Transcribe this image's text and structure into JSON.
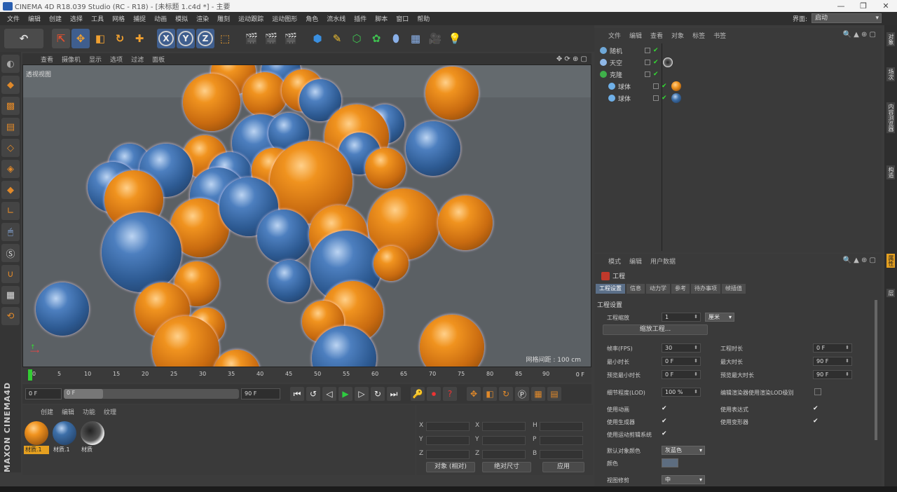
{
  "window": {
    "title": "CINEMA 4D R18.039 Studio (RC - R18) - [未标题 1.c4d *] - 主要"
  },
  "menu": [
    "文件",
    "编辑",
    "创建",
    "选择",
    "工具",
    "网格",
    "捕捉",
    "动画",
    "模拟",
    "渲染",
    "雕刻",
    "运动跟踪",
    "运动图形",
    "角色",
    "流水线",
    "插件",
    "脚本",
    "窗口",
    "帮助"
  ],
  "layout": {
    "label": "界面:",
    "value": "启动"
  },
  "viewport": {
    "menu": [
      "查看",
      "摄像机",
      "显示",
      "选项",
      "过滤",
      "面板"
    ],
    "label": "透视视图",
    "grid_spacing": "网格间距 : 100 cm"
  },
  "timeline": {
    "ticks": [
      "0",
      "5",
      "10",
      "15",
      "20",
      "25",
      "30",
      "35",
      "40",
      "45",
      "50",
      "55",
      "60",
      "65",
      "70",
      "75",
      "80",
      "85",
      "90"
    ],
    "current_frame": "0 F"
  },
  "transport": {
    "start": "0 F",
    "slider": "0 F",
    "end": "90 F"
  },
  "materials": {
    "menu": [
      "创建",
      "编辑",
      "功能",
      "纹理"
    ],
    "items": [
      {
        "name": "材质.1",
        "color": "orange",
        "selected": true
      },
      {
        "name": "材质.1",
        "color": "blue",
        "selected": false
      },
      {
        "name": "材质",
        "color": "glass",
        "selected": false
      }
    ]
  },
  "coords": {
    "labels_col1": [
      "X",
      "Y",
      "Z"
    ],
    "labels_col2": [
      "X",
      "Y",
      "Z"
    ],
    "labels_col3": [
      "H",
      "P",
      "B"
    ],
    "mode1": "对象 (相对)",
    "mode2": "绝对尺寸",
    "apply": "应用"
  },
  "objects": {
    "menu": [
      "文件",
      "编辑",
      "查看",
      "对象",
      "标签",
      "书签"
    ],
    "items": [
      {
        "name": "随机",
        "icon": "gear-icon",
        "color": "#6fa8d8",
        "indent": 0
      },
      {
        "name": "天空",
        "icon": "sphere-icon",
        "color": "#8fb8e8",
        "indent": 0
      },
      {
        "name": "克隆",
        "icon": "cloner-icon",
        "color": "#3fb04a",
        "indent": 0
      },
      {
        "name": "球体",
        "icon": "sphere-icon",
        "color": "#6fb0e8",
        "indent": 1
      },
      {
        "name": "球体",
        "icon": "sphere-icon",
        "color": "#6fb0e8",
        "indent": 1
      }
    ]
  },
  "attributes": {
    "menu": [
      "模式",
      "编辑",
      "用户数据"
    ],
    "title": "工程",
    "tabs": [
      "工程设置",
      "信息",
      "动力学",
      "参考",
      "待办事项",
      "帧插值"
    ],
    "active_tab": "工程设置",
    "section": "工程设置",
    "scale_label": "工程缩放",
    "scale_value": "1",
    "scale_unit": "厘米",
    "scale_button": "缩放工程...",
    "fps_label": "帧率(FPS)",
    "fps": "30",
    "project_time_label": "工程时长",
    "project_time": "0 F",
    "min_time_label": "最小时长",
    "min_time": "0 F",
    "max_time_label": "最大时长",
    "max_time": "90 F",
    "preview_min_label": "预览最小时长",
    "preview_min": "0 F",
    "preview_max_label": "预览最大时长",
    "preview_max": "90 F",
    "lod_label": "细节程度(LOD)",
    "lod": "100 %",
    "render_lod_label": "编辑渲染器使用渲染LOD级别",
    "use_anim_label": "使用动画",
    "use_expr_label": "使用表达式",
    "use_gen_label": "使用生成器",
    "use_deform_label": "使用变形器",
    "use_motion_label": "使用运动剪辑系统",
    "default_color_label": "默认对象颜色",
    "default_color": "灰蓝色",
    "color_label": "颜色",
    "view_clip_label": "视图修剪",
    "view_clip": "中"
  },
  "right_tabs": [
    "对象",
    "场次",
    "内容浏览器",
    "构造",
    "属性",
    "层"
  ]
}
